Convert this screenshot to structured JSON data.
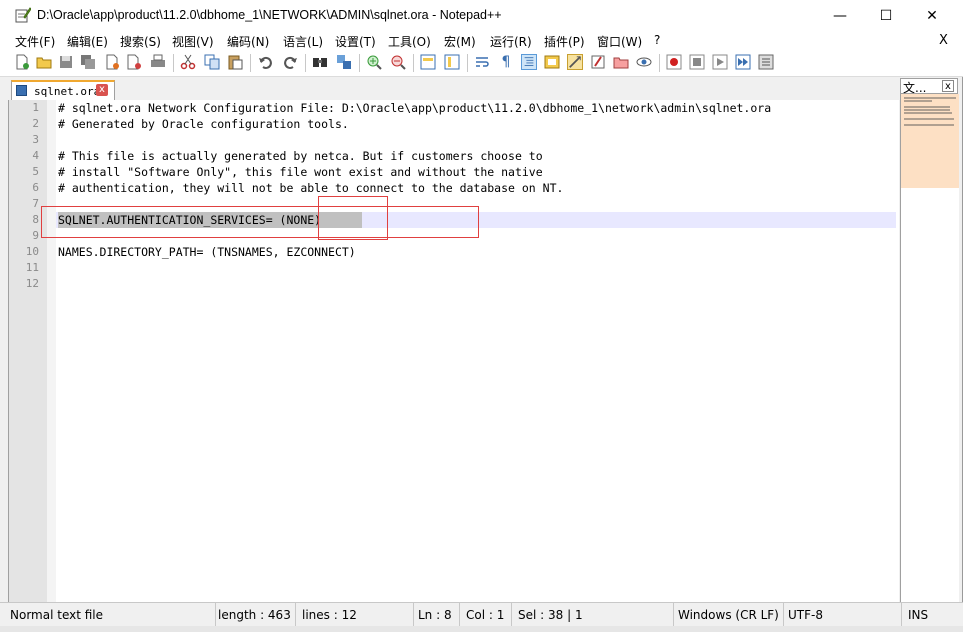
{
  "window": {
    "title": "D:\\Oracle\\app\\product\\11.2.0\\dbhome_1\\NETWORK\\ADMIN\\sqlnet.ora - Notepad++",
    "minimize": "—",
    "maximize": "☐",
    "close": "✕"
  },
  "menu": {
    "items": [
      "文件(F)",
      "编辑(E)",
      "搜索(S)",
      "视图(V)",
      "编码(N)",
      "语言(L)",
      "设置(T)",
      "工具(O)",
      "宏(M)",
      "运行(R)",
      "插件(P)",
      "窗口(W)",
      "?"
    ],
    "close": "X"
  },
  "tab": {
    "label": "sqlnet.ora",
    "close": "x"
  },
  "editor": {
    "line_numbers": [
      "1",
      "2",
      "3",
      "4",
      "5",
      "6",
      "7",
      "8",
      "9",
      "10",
      "11",
      "12"
    ],
    "lines": [
      "# sqlnet.ora Network Configuration File: D:\\Oracle\\app\\product\\11.2.0\\dbhome_1\\network\\admin\\sqlnet.ora",
      "# Generated by Oracle configuration tools.",
      "",
      "# This file is actually generated by netca. But if customers choose to",
      "# install \"Software Only\", this file wont exist and without the native",
      "# authentication, they will not be able to connect to the database on NT.",
      "",
      "SQLNET.AUTHENTICATION_SERVICES= (NONE)",
      "",
      "NAMES.DIRECTORY_PATH= (TNSNAMES, EZCONNECT)",
      "",
      ""
    ]
  },
  "docmap": {
    "title": "文...",
    "close": "x"
  },
  "status": {
    "file_type": "Normal text file",
    "length": "length : 463",
    "lines": "lines : 12",
    "ln": "Ln : 8",
    "col": "Col : 1",
    "sel": "Sel : 38 | 1",
    "eol": "Windows (CR LF)",
    "encoding": "UTF-8",
    "mode": "INS"
  },
  "colors": {
    "current_line": "#e8e8ff",
    "selection": "#c0c0c0",
    "annotation": "#e04040",
    "tab_accent": "#f0a830"
  }
}
